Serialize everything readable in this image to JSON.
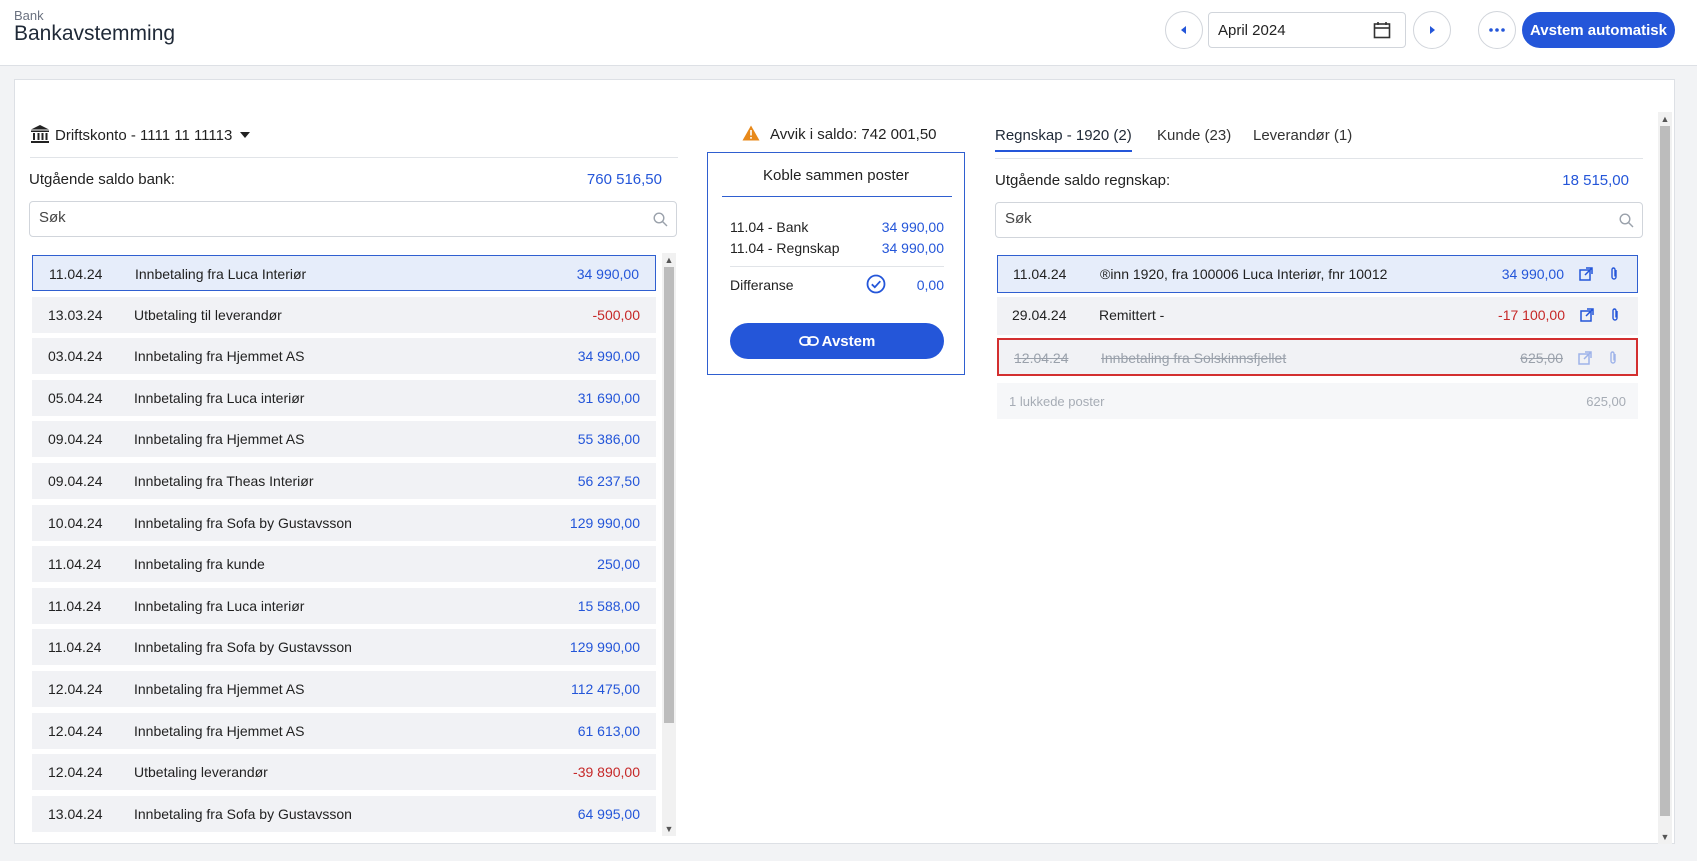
{
  "header": {
    "breadcrumb": "Bank",
    "title": "Bankavstemming",
    "period": "April 2024",
    "auto_button": "Avstem automatisk",
    "icons": [
      "chevron-left-icon",
      "calendar-icon",
      "chevron-right-icon",
      "more-icon"
    ]
  },
  "bank": {
    "account": "Driftskonto - 1111 11 11113",
    "saldo_label": "Utgående saldo bank:",
    "saldo_value": "760 516,50",
    "search_placeholder": "Søk",
    "rows": [
      {
        "date": "11.04.24",
        "text": "Innbetaling fra Luca Interiør",
        "amount": "34 990,00",
        "negative": false,
        "selected": true
      },
      {
        "date": "13.03.24",
        "text": "Utbetaling til leverandør",
        "amount": "-500,00",
        "negative": true,
        "selected": false
      },
      {
        "date": "03.04.24",
        "text": "Innbetaling fra Hjemmet AS",
        "amount": "34 990,00",
        "negative": false,
        "selected": false
      },
      {
        "date": "05.04.24",
        "text": "Innbetaling fra Luca interiør",
        "amount": "31 690,00",
        "negative": false,
        "selected": false
      },
      {
        "date": "09.04.24",
        "text": "Innbetaling fra Hjemmet AS",
        "amount": "55 386,00",
        "negative": false,
        "selected": false
      },
      {
        "date": "09.04.24",
        "text": "Innbetaling fra Theas Interiør",
        "amount": "56 237,50",
        "negative": false,
        "selected": false
      },
      {
        "date": "10.04.24",
        "text": "Innbetaling fra Sofa by Gustavsson",
        "amount": "129 990,00",
        "negative": false,
        "selected": false
      },
      {
        "date": "11.04.24",
        "text": "Innbetaling fra kunde",
        "amount": "250,00",
        "negative": false,
        "selected": false
      },
      {
        "date": "11.04.24",
        "text": "Innbetaling fra Luca interiør",
        "amount": "15 588,00",
        "negative": false,
        "selected": false
      },
      {
        "date": "11.04.24",
        "text": "Innbetaling fra Sofa by Gustavsson",
        "amount": "129 990,00",
        "negative": false,
        "selected": false
      },
      {
        "date": "12.04.24",
        "text": "Innbetaling fra Hjemmet AS",
        "amount": "112 475,00",
        "negative": false,
        "selected": false
      },
      {
        "date": "12.04.24",
        "text": "Innbetaling fra Hjemmet AS",
        "amount": "61 613,00",
        "negative": false,
        "selected": false
      },
      {
        "date": "12.04.24",
        "text": "Utbetaling leverandør",
        "amount": "-39 890,00",
        "negative": true,
        "selected": false
      },
      {
        "date": "13.04.24",
        "text": "Innbetaling fra Sofa by Gustavsson",
        "amount": "64 995,00",
        "negative": false,
        "selected": false
      }
    ]
  },
  "match": {
    "deviation": "Avvik i saldo: 742 001,50",
    "title": "Koble sammen poster",
    "lines": [
      {
        "label": "11.04 - Bank",
        "value": "34 990,00"
      },
      {
        "label": "11.04 - Regnskap",
        "value": "34 990,00"
      }
    ],
    "diff_label": "Differanse",
    "diff_value": "0,00",
    "button": "Avstem"
  },
  "ledger": {
    "tabs": [
      {
        "label": "Regnskap - 1920 (2)",
        "active": true
      },
      {
        "label": "Kunde (23)",
        "active": false
      },
      {
        "label": "Leverandør (1)",
        "active": false
      }
    ],
    "saldo_label": "Utgående saldo regnskap:",
    "saldo_value": "18 515,00",
    "search_placeholder": "Søk",
    "rows": [
      {
        "date": "11.04.24",
        "text": "®inn 1920, fra 100006 Luca Interiør, fnr 10012",
        "amount": "34 990,00",
        "negative": false,
        "state": "sel"
      },
      {
        "date": "29.04.24",
        "text": "Remittert -",
        "amount": "-17 100,00",
        "negative": true,
        "state": ""
      },
      {
        "date": "12.04.24",
        "text": "Innbetaling fra Solskinnsfjellet",
        "amount": "625,00",
        "negative": false,
        "state": "closed"
      }
    ],
    "closed_label": "1 lukkede poster",
    "closed_amount": "625,00"
  },
  "colors": {
    "accent": "#2456d9",
    "negative": "#c62828",
    "warning": "#e8891a",
    "closed_border": "#d32f2f"
  }
}
